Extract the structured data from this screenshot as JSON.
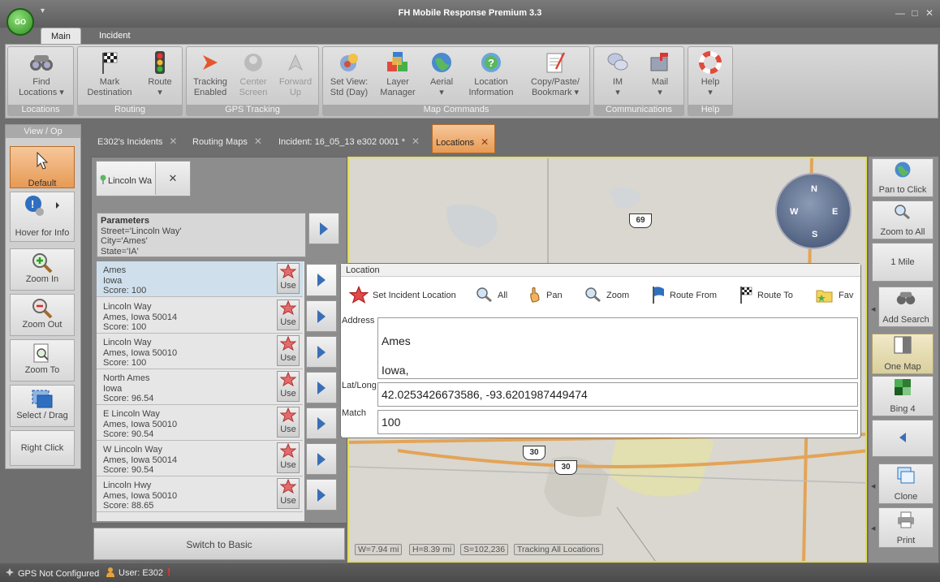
{
  "app": {
    "title": "FH Mobile Response Premium 3.3",
    "go_label": "GO",
    "qat_glyph": "▾",
    "window_buttons": [
      "—",
      "□",
      "✕"
    ]
  },
  "ribbon_tabs": [
    "Main",
    "Incident"
  ],
  "ribbon": {
    "groups": [
      {
        "label": "Locations",
        "buttons": [
          {
            "label": "Find\nLocations ▾",
            "icon": "binoculars-icon"
          }
        ]
      },
      {
        "label": "Routing",
        "buttons": [
          {
            "label": "Mark\nDestination",
            "icon": "checkered-flag-icon"
          },
          {
            "label": "Route\n▾",
            "icon": "traffic-light-icon"
          }
        ]
      },
      {
        "label": "GPS Tracking",
        "buttons": [
          {
            "label": "Tracking\nEnabled",
            "icon": "tracking-arrow-icon"
          },
          {
            "label": "Center\nScreen",
            "icon": "center-screen-icon",
            "disabled": true
          },
          {
            "label": "Forward\nUp",
            "icon": "forward-up-icon",
            "disabled": true
          }
        ]
      },
      {
        "label": "Map Commands",
        "buttons": [
          {
            "label": "Set View:\nStd (Day)",
            "icon": "set-view-icon"
          },
          {
            "label": "Layer\nManager",
            "icon": "layers-icon"
          },
          {
            "label": "Aerial\n▾",
            "icon": "globe-icon"
          },
          {
            "label": "Location\nInformation",
            "icon": "location-info-icon"
          },
          {
            "label": "Copy/Paste/\nBookmark ▾",
            "icon": "notepad-icon"
          }
        ]
      },
      {
        "label": "Communications",
        "buttons": [
          {
            "label": "IM\n▾",
            "icon": "chat-icon"
          },
          {
            "label": "Mail\n▾",
            "icon": "mailbox-icon"
          }
        ]
      },
      {
        "label": "Help",
        "buttons": [
          {
            "label": "Help\n▾",
            "icon": "lifebuoy-icon"
          }
        ]
      }
    ]
  },
  "left_toolbar": {
    "title": "View / Op",
    "buttons": [
      {
        "label": "Default",
        "icon": "pointer-icon",
        "active": true
      },
      {
        "label": "Hover for Info",
        "icon": "info-hover-icon"
      },
      {
        "label": "Zoom In",
        "icon": "zoom-in-icon"
      },
      {
        "label": "Zoom Out",
        "icon": "zoom-out-icon"
      },
      {
        "label": "Zoom To",
        "icon": "zoom-to-icon"
      },
      {
        "label": "Select / Drag",
        "icon": "select-drag-icon"
      },
      {
        "label": "Right Click",
        "icon": ""
      }
    ]
  },
  "doc_tabs": [
    "E302's Incidents",
    "Routing Maps",
    "Incident: 16_05_13 e302 0001 *",
    "Locations"
  ],
  "search_panel": {
    "search_tab_label": "Lincoln Wa",
    "params_title": "Parameters",
    "params_lines": [
      "Street='Lincoln Way'",
      "City='Ames'",
      "State='IA'"
    ],
    "use_label": "Use",
    "results": [
      {
        "line1": "Ames",
        "line2": "Iowa",
        "score": "Score:  100"
      },
      {
        "line1": "Lincoln Way",
        "line2": "Ames, Iowa  50014",
        "score": "Score:  100"
      },
      {
        "line1": "Lincoln Way",
        "line2": "Ames, Iowa  50010",
        "score": "Score:  100"
      },
      {
        "line1": "North Ames",
        "line2": "Iowa",
        "score": "Score:  96.54"
      },
      {
        "line1": "E Lincoln Way",
        "line2": "Ames, Iowa  50010",
        "score": "Score:  90.54"
      },
      {
        "line1": "W Lincoln Way",
        "line2": "Ames, Iowa  50014",
        "score": "Score:  90.54"
      },
      {
        "line1": "Lincoln Hwy",
        "line2": "Ames, Iowa  50010",
        "score": "Score:  88.65"
      }
    ],
    "switch_label": "Switch to Basic"
  },
  "location_popup": {
    "title": "Location",
    "tools": [
      "Set Incident Location",
      "All",
      "Pan",
      "Zoom",
      "Route From",
      "Route To",
      "Fav"
    ],
    "address_label": "Address",
    "address_line1": "Ames",
    "address_line2": "Iowa,",
    "latlong_label": "Lat/Long",
    "latlong_value": "42.0253426673586, -93.6201987449474",
    "match_label": "Match",
    "match_value": "100"
  },
  "map": {
    "highway_labels": [
      "69",
      "30",
      "30"
    ],
    "compass_letters": [
      "N",
      "E",
      "S",
      "W"
    ],
    "status": [
      "W=7.94 mi",
      "H=8.39 mi",
      "S=102,236",
      "Tracking All Locations"
    ]
  },
  "right_toolbar": {
    "buttons": [
      {
        "label": "Pan to Click",
        "icon": "globe-icon"
      },
      {
        "label": "Zoom to All",
        "icon": "zoom-all-icon"
      },
      {
        "label": "1 Mile",
        "icon": ""
      },
      {
        "label": "Add Search",
        "icon": "binoculars-icon"
      },
      {
        "label": "One Map",
        "icon": "one-map-icon",
        "active": true
      },
      {
        "label": "Bing 4",
        "icon": "bing-icon"
      },
      {
        "label": "",
        "icon": "collapse-left-icon"
      },
      {
        "label": "Clone",
        "icon": "clone-icon"
      },
      {
        "label": "Print",
        "icon": "printer-icon"
      }
    ]
  },
  "statusbar": {
    "gps": "GPS Not Configured",
    "user": "User: E302"
  },
  "colors": {
    "accent_orange": "#e79a55",
    "map_border": "#e0dd5a",
    "arrow_blue": "#3a6fb8"
  }
}
